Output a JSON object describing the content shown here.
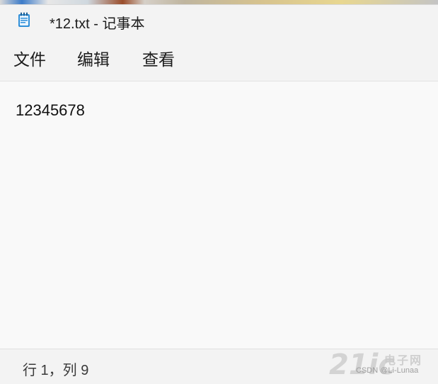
{
  "window": {
    "title": "*12.txt - 记事本"
  },
  "menu": {
    "items": [
      {
        "label": "文件"
      },
      {
        "label": "编辑"
      },
      {
        "label": "查看"
      }
    ]
  },
  "editor": {
    "content": "12345678"
  },
  "status": {
    "position": "行 1，列 9"
  },
  "watermark": {
    "logo": "21ic",
    "site_cn": "电子网",
    "credit": "CSDN @Li-Lunaa"
  },
  "icons": {
    "app": "notepad-icon"
  },
  "colors": {
    "titlebar": "#f3f3f3",
    "editor_bg": "#f9f9f9",
    "statusbar": "#f3f3f3"
  }
}
